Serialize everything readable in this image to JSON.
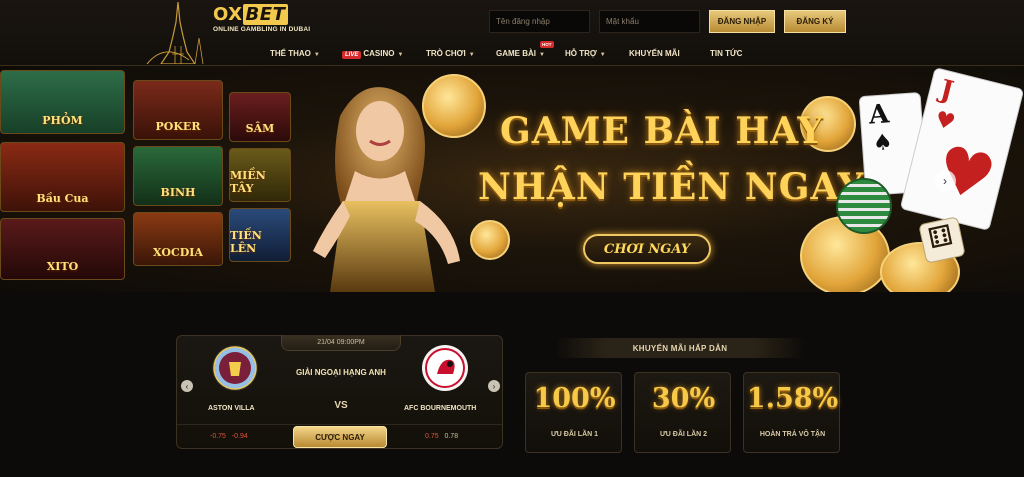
{
  "brand": {
    "name_part1": "OX",
    "name_part2": "BET",
    "tagline": "ONLINE GAMBLING IN DUBAI"
  },
  "login": {
    "username_placeholder": "Tên đăng nhập",
    "password_placeholder": "Mật khẩu",
    "login_label": "ĐĂNG NHẬP",
    "register_label": "ĐĂNG KÝ"
  },
  "nav": {
    "items": [
      {
        "label": "THỂ THAO"
      },
      {
        "label": "CASINO",
        "badge": "LIVE"
      },
      {
        "label": "TRÒ CHƠI"
      },
      {
        "label": "GAME BÀI",
        "badge": "HOT"
      },
      {
        "label": "HỖ TRỢ"
      },
      {
        "label": "KHUYẾN MÃI"
      },
      {
        "label": "TIN TỨC"
      }
    ]
  },
  "banner": {
    "headline_line1": "GAME BÀI HAY",
    "headline_line2": "NHẬN TIỀN NGAY",
    "cta_label": "CHƠI NGAY",
    "game_tiles": [
      "PHỎM",
      "POKER",
      "SÂM",
      "Bầu Cua",
      "BINH",
      "MIỀN TÂY",
      "XITO",
      "XOCDIA",
      "TIẾN LÊN"
    ],
    "card_rank_1": "A",
    "card_rank_2": "J",
    "slide_count": 5,
    "active_slide": 1
  },
  "match": {
    "datetime": "21/04 09:00PM",
    "league": "GIẢI NGOẠI HẠNG ANH",
    "vs_label": "VS",
    "home_team": "ASTON VILLA",
    "away_team": "AFC BOURNEMOUTH",
    "home_odds": [
      "-0.75",
      "-0.94"
    ],
    "away_odds": [
      "0.75",
      "0.78"
    ],
    "bet_label": "CƯỢC NGAY"
  },
  "promo": {
    "title": "KHUYẾN MÃI HẤP DẪN",
    "cards": [
      {
        "value": "100%",
        "label": "ƯU ĐÃI LẦN 1"
      },
      {
        "value": "30%",
        "label": "ƯU ĐÃI LẦN 2"
      },
      {
        "value": "1.58%",
        "label": "HOÀN TRẢ VÔ TẬN"
      }
    ]
  },
  "colors": {
    "accent_gold": "#f2c94c",
    "background": "#0d0b09",
    "live_red": "#d62b2b"
  }
}
